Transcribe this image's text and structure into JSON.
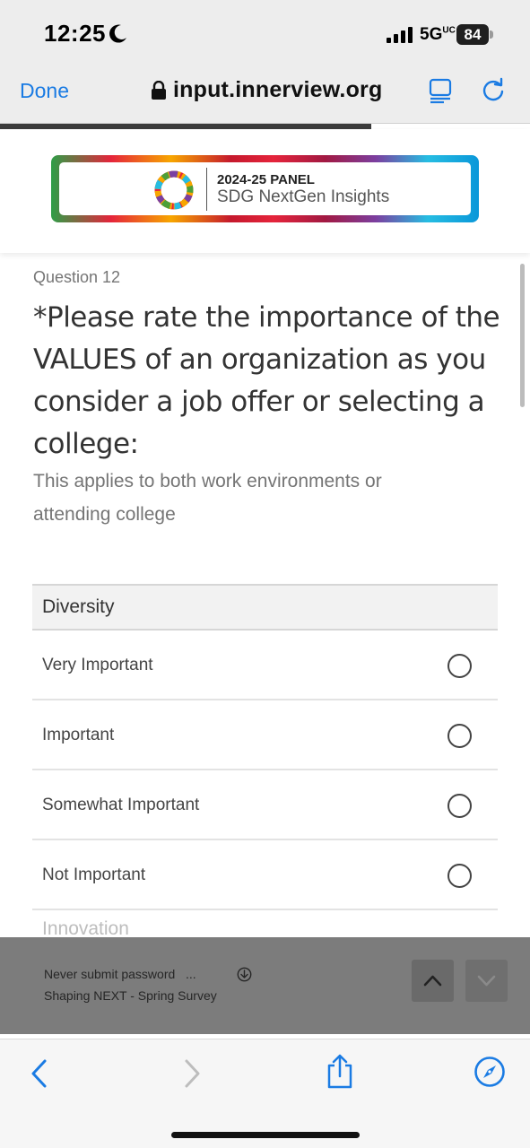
{
  "status_bar": {
    "time": "12:25",
    "network": "5G",
    "network_suffix": "UC",
    "battery": "84",
    "moon_icon": "moon-icon",
    "signal_icon": "cellular-signal-icon"
  },
  "browser": {
    "done_label": "Done",
    "url": "input.innerview.org",
    "page_load_progress": 0.7,
    "icons": [
      "lock-icon",
      "reader-icon",
      "reload-icon"
    ]
  },
  "banner": {
    "title": "2024-25 PANEL",
    "subtitle": "SDG NextGen Insights",
    "icon": "sdg-wheel-icon"
  },
  "question": {
    "number_label": "Question 12",
    "text": "*Please rate the importance of the VALUES of an organization as you consider a job offer or selecting a college:",
    "help": "This applies to both work environments or attending college"
  },
  "matrix": {
    "category": "Diversity",
    "options": [
      {
        "label": "Very Important",
        "selected": false
      },
      {
        "label": "Important",
        "selected": false
      },
      {
        "label": "Somewhat Important",
        "selected": false
      },
      {
        "label": "Not Important",
        "selected": false
      }
    ],
    "next_category": "Innovation"
  },
  "autofill": {
    "line1": "Never submit password",
    "ellipsis": "...",
    "line2": "Shaping NEXT - Spring Survey"
  },
  "colors": {
    "accent": "#1a7be3",
    "header_bg": "#ededed",
    "autofill_bg": "#7c7c7c",
    "text": "#333333"
  },
  "toolbar": {
    "icons": [
      "back-icon",
      "forward-icon",
      "share-icon",
      "compass-icon"
    ]
  }
}
